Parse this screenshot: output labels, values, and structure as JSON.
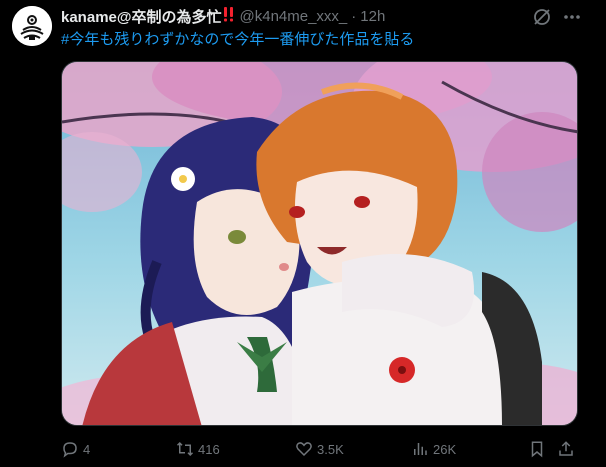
{
  "tweet": {
    "display_name": "kaname@卒制の為多忙",
    "name_badge": "‼️",
    "handle": "@k4n4me_xxx_",
    "separator": "·",
    "time": "12h",
    "hashtag": "#今年も残りわずかなので今年一番伸びた作品を貼る"
  },
  "actions": {
    "replies": "4",
    "retweets": "416",
    "likes": "3.5K",
    "views": "26K"
  },
  "icons": {
    "avatar": "target-logo-icon",
    "grok": "grok-icon",
    "more": "more-horizontal-icon",
    "reply": "reply-icon",
    "retweet": "retweet-icon",
    "like": "heart-icon",
    "views": "views-chart-icon",
    "bookmark": "bookmark-icon",
    "share": "share-icon"
  },
  "colors": {
    "background": "#000000",
    "text": "#e7e9ea",
    "muted": "#71767b",
    "link": "#1d9bf0",
    "badge": "#f4212e"
  }
}
